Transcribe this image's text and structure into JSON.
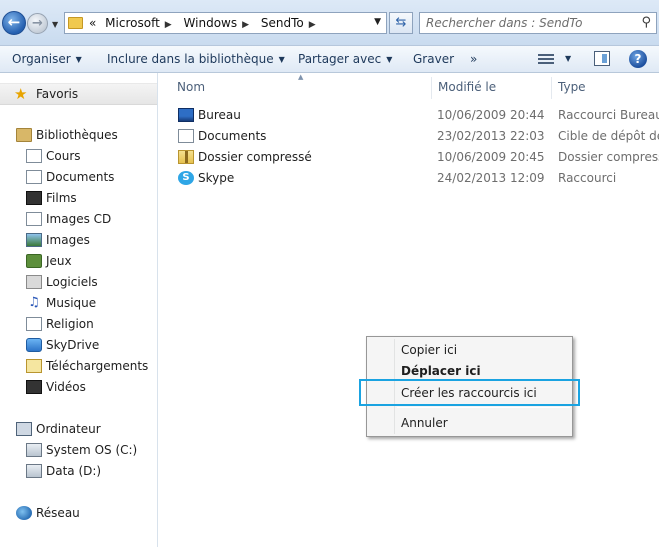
{
  "address_bar": {
    "overflow": "«",
    "crumbs": [
      "Microsoft",
      "Windows",
      "SendTo"
    ],
    "search_placeholder": "Rechercher dans : SendTo"
  },
  "toolbar": {
    "organise": "Organiser",
    "include": "Inclure dans la bibliothèque",
    "share": "Partager avec",
    "burn": "Graver",
    "more": "»"
  },
  "nav": {
    "favorites": "Favoris",
    "libraries": "Bibliothèques",
    "library_items": [
      "Cours",
      "Documents",
      "Films",
      "Images CD",
      "Images",
      "Jeux",
      "Logiciels",
      "Musique",
      "Religion",
      "SkyDrive",
      "Téléchargements",
      "Vidéos"
    ],
    "computer": "Ordinateur",
    "drives": [
      "System OS (C:)",
      "Data (D:)"
    ],
    "network": "Réseau"
  },
  "columns": {
    "name": "Nom",
    "modified": "Modifié le",
    "type": "Type"
  },
  "files": [
    {
      "name": "Bureau",
      "date": "10/06/2009 20:44",
      "type": "Raccourci Bureau",
      "icon": "desktop-icon"
    },
    {
      "name": "Documents",
      "date": "23/02/2013 22:03",
      "type": "Cible de dépôt de M",
      "icon": "document-icon"
    },
    {
      "name": "Dossier compressé",
      "date": "10/06/2009 20:45",
      "type": "Dossier compressé",
      "icon": "zip-folder-icon"
    },
    {
      "name": "Skype",
      "date": "24/02/2013 12:09",
      "type": "Raccourci",
      "icon": "skype-icon"
    }
  ],
  "context_menu": {
    "copy": "Copier ici",
    "move": "Déplacer ici",
    "shortcut": "Créer les raccourcis ici",
    "cancel": "Annuler"
  },
  "colors": {
    "highlight_border": "#1aa3e1",
    "toolbar_text": "#1e395b"
  }
}
